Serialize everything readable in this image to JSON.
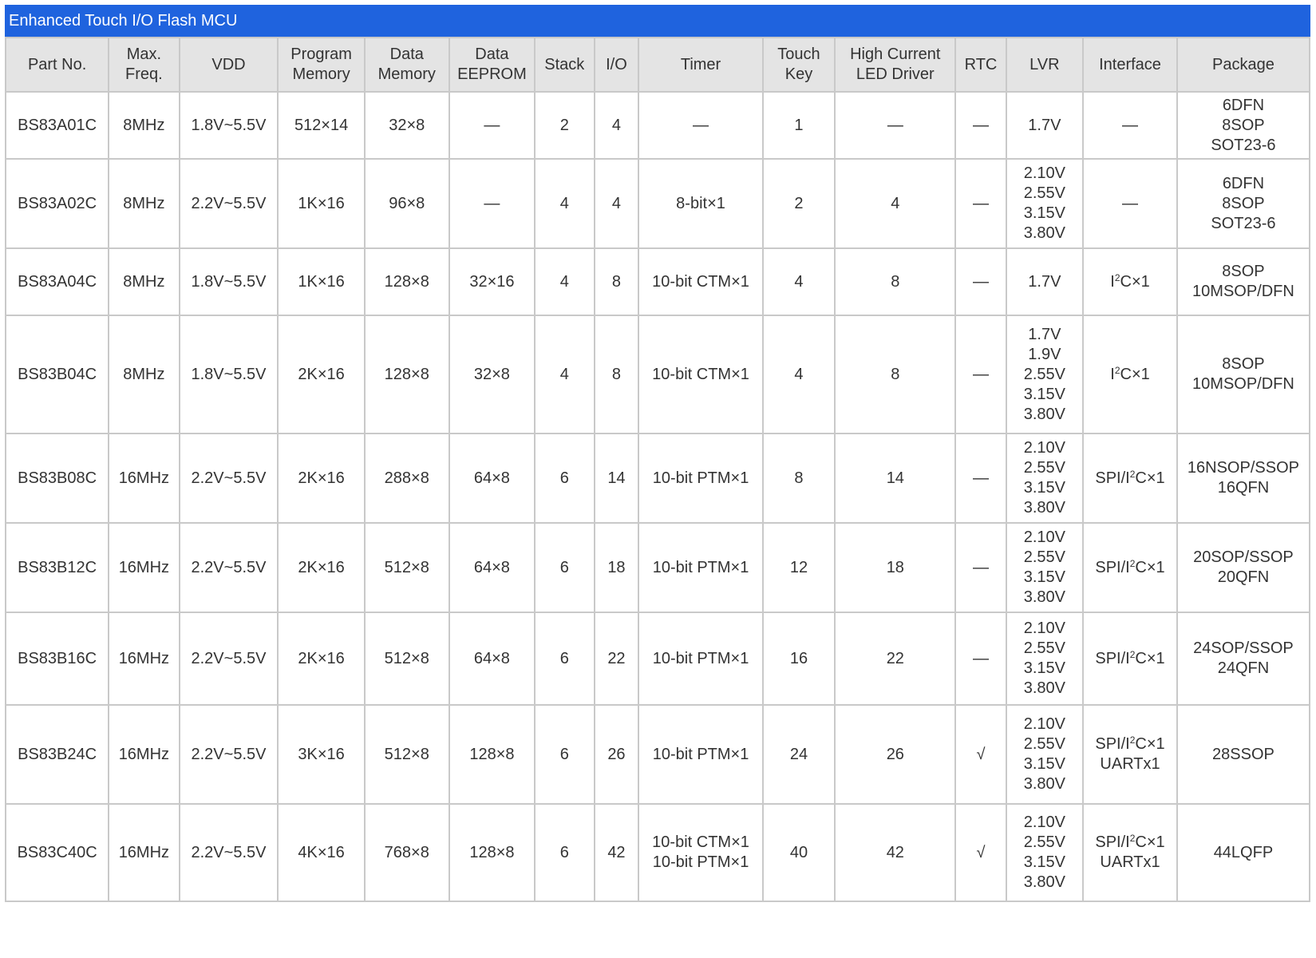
{
  "title": "Enhanced Touch I/O Flash MCU",
  "headers": [
    [
      "Part No."
    ],
    [
      "Max.",
      "Freq."
    ],
    [
      "VDD"
    ],
    [
      "Program",
      "Memory"
    ],
    [
      "Data",
      "Memory"
    ],
    [
      "Data",
      "EEPROM"
    ],
    [
      "Stack"
    ],
    [
      "I/O"
    ],
    [
      "Timer"
    ],
    [
      "Touch",
      "Key"
    ],
    [
      "High Current",
      "LED Driver"
    ],
    [
      "RTC"
    ],
    [
      "LVR"
    ],
    [
      "Interface"
    ],
    [
      "Package"
    ]
  ],
  "rows": [
    {
      "part": "BS83A01C",
      "freq": "8MHz",
      "vdd": "1.8V~5.5V",
      "prog": "512×14",
      "data": "32×8",
      "eeprom": "—",
      "stack": "2",
      "io": "4",
      "timer": [
        "—"
      ],
      "touch": "1",
      "led": "—",
      "rtc": "—",
      "lvr": [
        "1.7V"
      ],
      "iface": [
        {
          "pre": "—"
        }
      ],
      "pkg": [
        "6DFN",
        "8SOP",
        "SOT23-6"
      ]
    },
    {
      "part": "BS83A02C",
      "freq": "8MHz",
      "vdd": "2.2V~5.5V",
      "prog": "1K×16",
      "data": "96×8",
      "eeprom": "—",
      "stack": "4",
      "io": "4",
      "timer": [
        "8-bit×1"
      ],
      "touch": "2",
      "led": "4",
      "rtc": "—",
      "lvr": [
        "2.10V",
        "2.55V",
        "3.15V",
        "3.80V"
      ],
      "iface": [
        {
          "pre": "—"
        }
      ],
      "pkg": [
        "6DFN",
        "8SOP",
        "SOT23-6"
      ]
    },
    {
      "part": "BS83A04C",
      "freq": "8MHz",
      "vdd": "1.8V~5.5V",
      "prog": "1K×16",
      "data": "128×8",
      "eeprom": "32×16",
      "stack": "4",
      "io": "8",
      "timer": [
        "10-bit CTM×1"
      ],
      "touch": "4",
      "led": "8",
      "rtc": "—",
      "lvr": [
        "1.7V"
      ],
      "iface": [
        {
          "pre": "I",
          "sup": "2",
          "post": "C×1"
        }
      ],
      "pkg": [
        "8SOP",
        "10MSOP/DFN"
      ]
    },
    {
      "part": "BS83B04C",
      "freq": "8MHz",
      "vdd": "1.8V~5.5V",
      "prog": "2K×16",
      "data": "128×8",
      "eeprom": "32×8",
      "stack": "4",
      "io": "8",
      "timer": [
        "10-bit CTM×1"
      ],
      "touch": "4",
      "led": "8",
      "rtc": "—",
      "lvr": [
        "1.7V",
        "1.9V",
        "2.55V",
        "3.15V",
        "3.80V"
      ],
      "iface": [
        {
          "pre": "I",
          "sup": "2",
          "post": "C×1"
        }
      ],
      "pkg": [
        "8SOP",
        "10MSOP/DFN"
      ]
    },
    {
      "part": "BS83B08C",
      "freq": "16MHz",
      "vdd": "2.2V~5.5V",
      "prog": "2K×16",
      "data": "288×8",
      "eeprom": "64×8",
      "stack": "6",
      "io": "14",
      "timer": [
        "10-bit PTM×1"
      ],
      "touch": "8",
      "led": "14",
      "rtc": "—",
      "lvr": [
        "2.10V",
        "2.55V",
        "3.15V",
        "3.80V"
      ],
      "iface": [
        {
          "pre": "SPI/I",
          "sup": "2",
          "post": "C×1"
        }
      ],
      "pkg": [
        "16NSOP/SSOP",
        "16QFN"
      ]
    },
    {
      "part": "BS83B12C",
      "freq": "16MHz",
      "vdd": "2.2V~5.5V",
      "prog": "2K×16",
      "data": "512×8",
      "eeprom": "64×8",
      "stack": "6",
      "io": "18",
      "timer": [
        "10-bit PTM×1"
      ],
      "touch": "12",
      "led": "18",
      "rtc": "—",
      "lvr": [
        "2.10V",
        "2.55V",
        "3.15V",
        "3.80V"
      ],
      "iface": [
        {
          "pre": "SPI/I",
          "sup": "2",
          "post": "C×1"
        }
      ],
      "pkg": [
        "20SOP/SSOP",
        "20QFN"
      ]
    },
    {
      "part": "BS83B16C",
      "freq": "16MHz",
      "vdd": "2.2V~5.5V",
      "prog": "2K×16",
      "data": "512×8",
      "eeprom": "64×8",
      "stack": "6",
      "io": "22",
      "timer": [
        "10-bit PTM×1"
      ],
      "touch": "16",
      "led": "22",
      "rtc": "—",
      "lvr": [
        "2.10V",
        "2.55V",
        "3.15V",
        "3.80V"
      ],
      "iface": [
        {
          "pre": "SPI/I",
          "sup": "2",
          "post": "C×1"
        }
      ],
      "pkg": [
        "24SOP/SSOP",
        "24QFN"
      ]
    },
    {
      "part": "BS83B24C",
      "freq": "16MHz",
      "vdd": "2.2V~5.5V",
      "prog": "3K×16",
      "data": "512×8",
      "eeprom": "128×8",
      "stack": "6",
      "io": "26",
      "timer": [
        "10-bit PTM×1"
      ],
      "touch": "24",
      "led": "26",
      "rtc": "√",
      "lvr": [
        "2.10V",
        "2.55V",
        "3.15V",
        "3.80V"
      ],
      "iface": [
        {
          "pre": "SPI/I",
          "sup": "2",
          "post": "C×1"
        },
        {
          "pre": "UARTx1"
        }
      ],
      "pkg": [
        "28SSOP"
      ]
    },
    {
      "part": "BS83C40C",
      "freq": "16MHz",
      "vdd": "2.2V~5.5V",
      "prog": "4K×16",
      "data": "768×8",
      "eeprom": "128×8",
      "stack": "6",
      "io": "42",
      "timer": [
        "10-bit CTM×1",
        "10-bit PTM×1"
      ],
      "touch": "40",
      "led": "42",
      "rtc": "√",
      "lvr": [
        "2.10V",
        "2.55V",
        "3.15V",
        "3.80V"
      ],
      "iface": [
        {
          "pre": "SPI/I",
          "sup": "2",
          "post": "C×1"
        },
        {
          "pre": "UARTx1"
        }
      ],
      "pkg": [
        "44LQFP"
      ]
    }
  ]
}
